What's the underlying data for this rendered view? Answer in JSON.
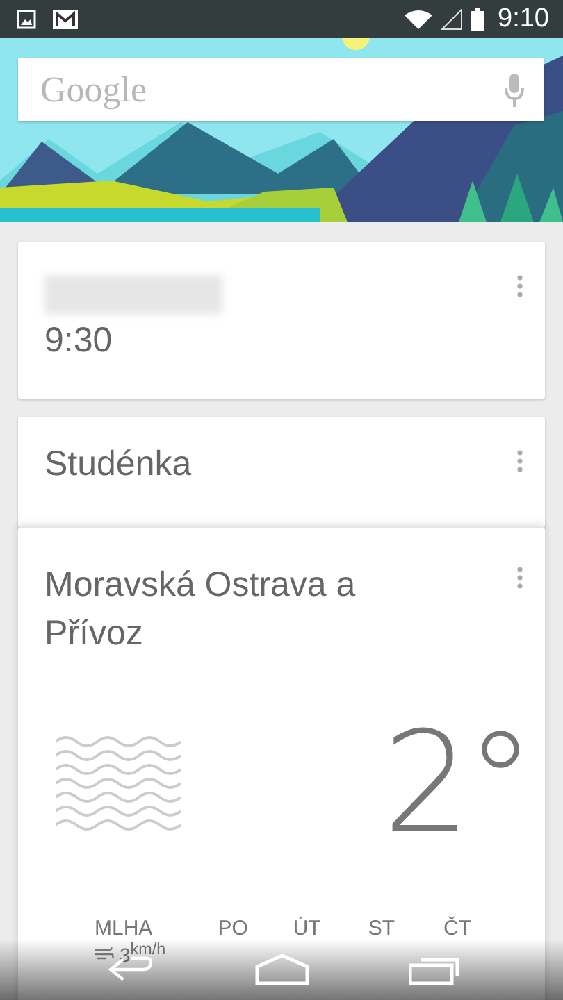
{
  "status_bar": {
    "time": "9:10"
  },
  "search": {
    "placeholder": "Google"
  },
  "cards": [
    {
      "kind": "event",
      "time": "9:30"
    },
    {
      "kind": "place",
      "title": "Studénka"
    },
    {
      "kind": "weather",
      "title": "Moravská Ostrava a Přívoz",
      "temperature": "2°",
      "condition": "MLHA",
      "wind": "3$^{km/h}$",
      "days": [
        "PO",
        "ÚT",
        "ST",
        "ČT"
      ]
    }
  ]
}
